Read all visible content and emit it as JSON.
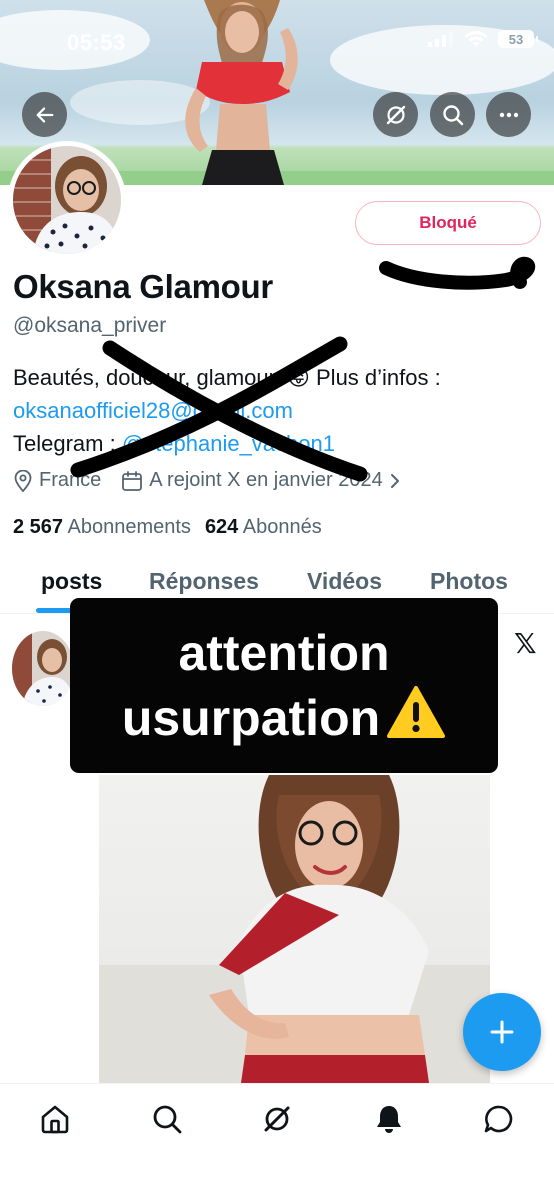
{
  "status_bar": {
    "time": "05:53",
    "battery": "53"
  },
  "header": {
    "back_icon": "arrow-left-icon",
    "grok_icon": "grok-icon",
    "search_icon": "search-icon",
    "more_icon": "more-horizontal-icon"
  },
  "profile": {
    "blocked_label": "Bloqué",
    "display_name": "Oksana Glamour",
    "handle": "@oksana_priver",
    "bio_line1": "Beautés, douceur, glamour. 😜 Plus d’infos :",
    "bio_email": "oksanaofficiel28@gmail.com",
    "bio_line3_prefix": "Telegram : ",
    "bio_telegram": "@stephanie_vachon1",
    "location": "France",
    "joined": "A rejoint X en janvier 2024",
    "following_count": "2 567",
    "following_label": "Abonnements",
    "followers_count": "624",
    "followers_label": "Abonnés"
  },
  "tabs": [
    {
      "label": "posts",
      "active": true
    },
    {
      "label": "Réponses",
      "active": false
    },
    {
      "label": "Vidéos",
      "active": false
    },
    {
      "label": "Photos",
      "active": false
    }
  ],
  "overlay": {
    "line1": "attention",
    "line2": "usurpation"
  },
  "bottom_nav": [
    "home-icon",
    "search-icon",
    "grok-icon",
    "notifications-icon",
    "messages-icon"
  ],
  "colors": {
    "accent": "#1d9bf0",
    "blocked": "#e0245e",
    "muted": "#536471"
  }
}
